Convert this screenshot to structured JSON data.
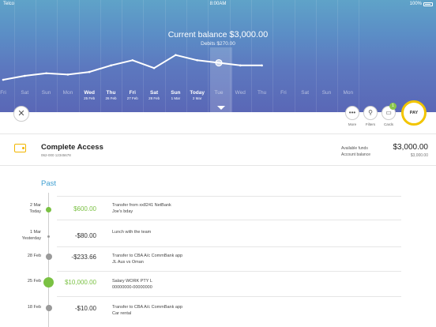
{
  "status_bar": {
    "carrier": "Telco",
    "time": "8:00AM",
    "battery": "100%"
  },
  "header": {
    "balance_label": "Current balance",
    "balance_value": "$3,000.00",
    "debits": "Debits $270.00"
  },
  "days": [
    {
      "name": "Fri",
      "date": "",
      "past": false
    },
    {
      "name": "Sat",
      "date": "",
      "past": false
    },
    {
      "name": "Sun",
      "date": "",
      "past": false
    },
    {
      "name": "Mon",
      "date": "",
      "past": false
    },
    {
      "name": "Wed",
      "date": "25 Feb",
      "past": true
    },
    {
      "name": "Thu",
      "date": "26 Feb",
      "past": true
    },
    {
      "name": "Fri",
      "date": "27 Feb",
      "past": true
    },
    {
      "name": "Sat",
      "date": "28 Feb",
      "past": true
    },
    {
      "name": "Sun",
      "date": "1 Mar",
      "past": true
    },
    {
      "name": "Today",
      "date": "2 Mar",
      "past": true
    },
    {
      "name": "Tue",
      "date": "",
      "past": false
    },
    {
      "name": "Wed",
      "date": "",
      "past": false
    },
    {
      "name": "Thu",
      "date": "",
      "past": false
    },
    {
      "name": "Fri",
      "date": "",
      "past": false
    },
    {
      "name": "Sat",
      "date": "",
      "past": false
    },
    {
      "name": "Sun",
      "date": "",
      "past": false
    },
    {
      "name": "Mon",
      "date": "",
      "past": false
    }
  ],
  "balance_trend": [
    85,
    88,
    90,
    89,
    91,
    96,
    100,
    94,
    104,
    100,
    98,
    96,
    96
  ],
  "actions": {
    "more": "More",
    "filters": "Filters",
    "cards": "Cards",
    "cards_badge": "1",
    "pay": "PAY"
  },
  "account": {
    "name": "Complete Access",
    "number": "062-000  12345678",
    "available_label": "Available funds",
    "available_value": "$3,000.00",
    "balance_label": "Account balance",
    "balance_value": "$3,000.00"
  },
  "section_title": "Past",
  "transactions": [
    {
      "date": "2 Mar",
      "sub": "Today",
      "amount": "$600.00",
      "credit": true,
      "desc1": "Transfer from xx8241 NetBank",
      "desc2": "Joe's bday"
    },
    {
      "date": "1 Mar",
      "sub": "Yesterday",
      "amount": "-$80.00",
      "credit": false,
      "desc1": "Lunch with the team",
      "desc2": ""
    },
    {
      "date": "28 Feb",
      "sub": "",
      "amount": "-$233.66",
      "credit": false,
      "desc1": "Transfer to CBA A/c CommBank app",
      "desc2": "JL Aus vs Oman"
    },
    {
      "date": "25 Feb",
      "sub": "",
      "amount": "$10,000.00",
      "credit": true,
      "desc1": "Salary WORK PTY L",
      "desc2": "00000000-00000000"
    },
    {
      "date": "18 Feb",
      "sub": "",
      "amount": "-$10.00",
      "credit": false,
      "desc1": "Transfer to CBA A/c CommBank app",
      "desc2": "Car rental"
    }
  ],
  "colors": {
    "accent": "#3f9fd1",
    "credit": "#7ac143",
    "pay_ring": "#f2c500"
  }
}
